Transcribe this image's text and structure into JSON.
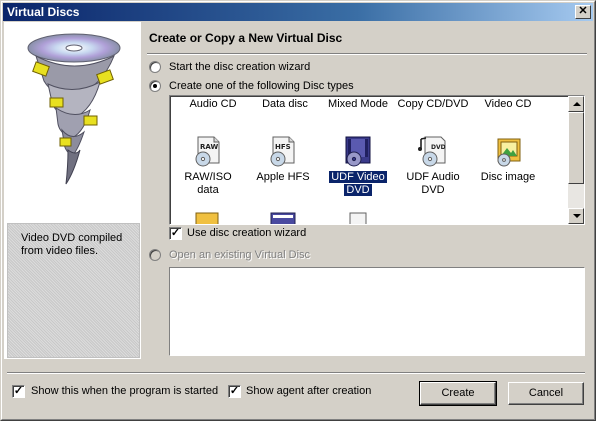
{
  "window": {
    "title": "Virtual Discs",
    "close_glyph": "✕"
  },
  "sidebar": {
    "description": "Video DVD compiled from video files."
  },
  "main": {
    "heading": "Create or Copy a New Virtual Disc",
    "option_wizard": "Start the disc creation wizard",
    "option_types": "Create one of the following Disc types",
    "option_existing": "Open an existing Virtual Disc",
    "use_wizard_label": "Use disc creation wizard",
    "use_wizard_checked": true,
    "selected_option": "option_types"
  },
  "disc_types": {
    "categories": [
      "Audio CD",
      "Data disc",
      "Mixed Mode",
      "Copy CD/DVD",
      "Video CD"
    ],
    "items": [
      {
        "name": "RAW/ISO data",
        "line1": "RAW/ISO",
        "line2": "data",
        "icon": "raw-disc-icon",
        "badge": "RAW"
      },
      {
        "name": "Apple HFS",
        "line1": "Apple HFS",
        "line2": "",
        "icon": "hfs-disc-icon",
        "badge": "HFS"
      },
      {
        "name": "UDF Video DVD",
        "line1": "UDF Video",
        "line2": "DVD",
        "icon": "udf-video-dvd-icon",
        "selected": true
      },
      {
        "name": "UDF Audio DVD",
        "line1": "UDF Audio",
        "line2": "DVD",
        "icon": "udf-audio-dvd-icon",
        "badge": "DVD"
      },
      {
        "name": "Disc image",
        "line1": "Disc image",
        "line2": "",
        "icon": "disc-image-icon"
      }
    ]
  },
  "footer": {
    "show_on_start_label": "Show this when the program is started",
    "show_on_start_checked": true,
    "show_agent_label": "Show agent after creation",
    "show_agent_checked": true,
    "create_label": "Create",
    "cancel_label": "Cancel"
  },
  "colors": {
    "title_bar": "#0a246a",
    "selection": "#0a246a",
    "face": "#d4d0c8"
  }
}
